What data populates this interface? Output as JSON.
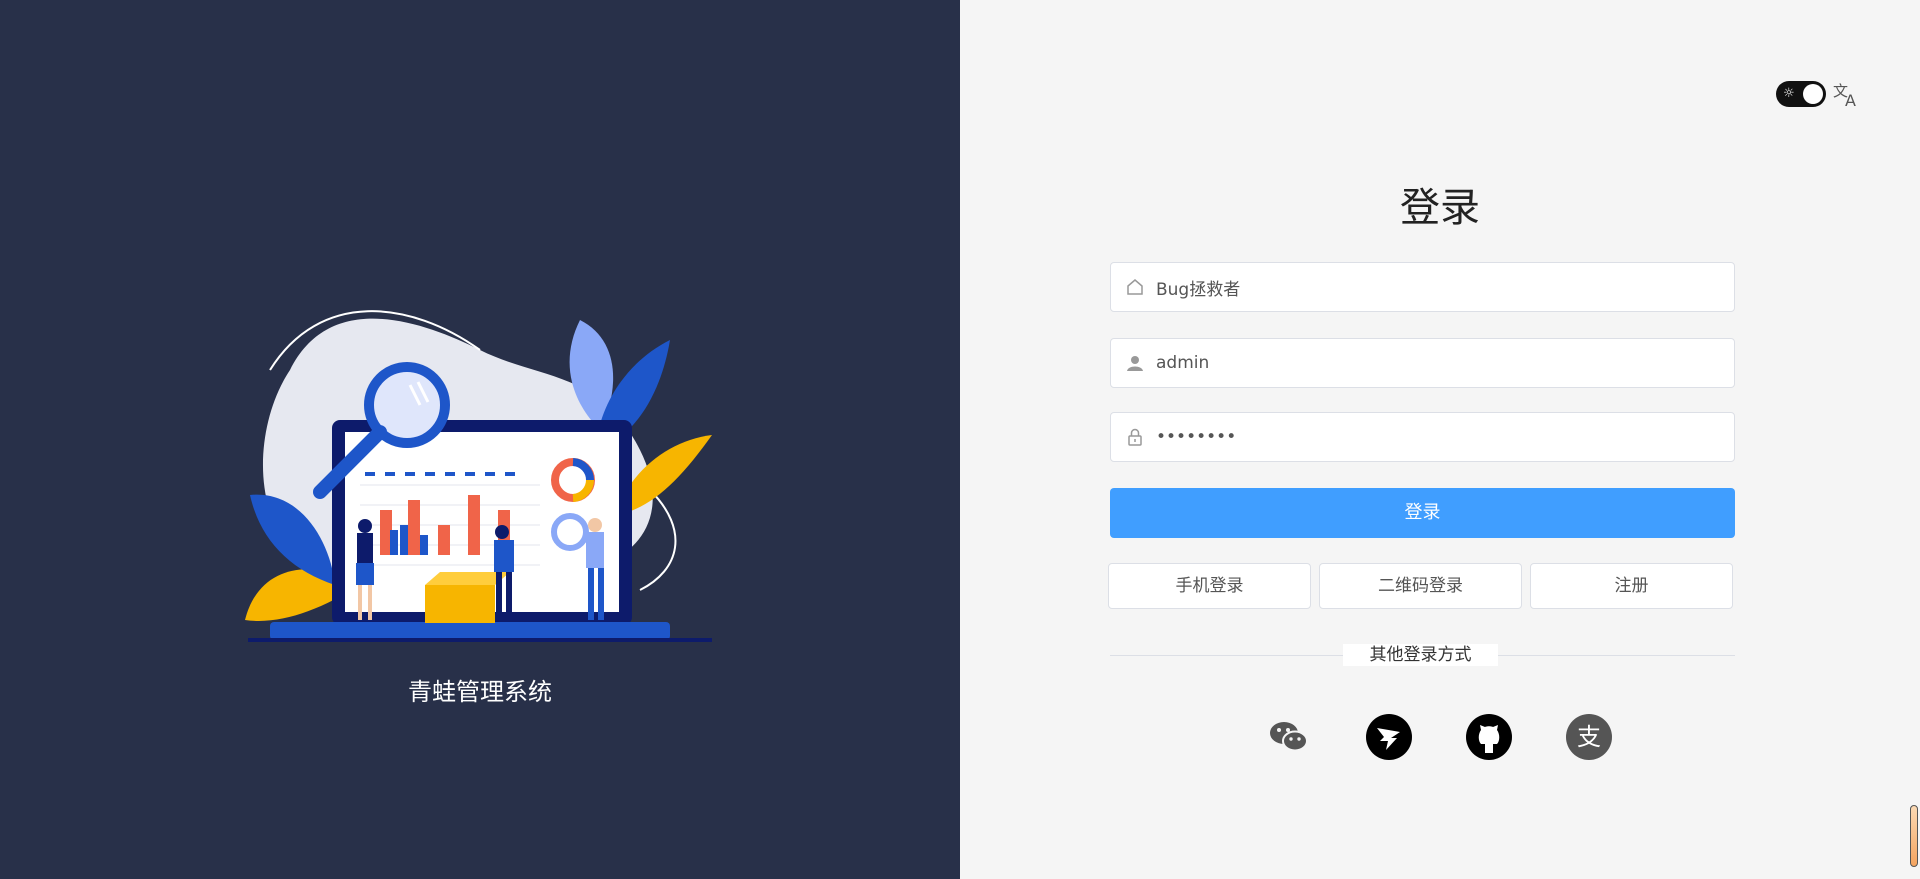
{
  "brand": {
    "app_name": "青蛙管理系统"
  },
  "header": {
    "theme_toggle_icon": "sun-icon",
    "language_icon": "translate-icon"
  },
  "login": {
    "title": "登录",
    "tenant_value": "Bug拯救者",
    "username_value": "admin",
    "password_value": "••••••••",
    "submit_label": "登录",
    "phone_login_label": "手机登录",
    "qrcode_login_label": "二维码登录",
    "register_label": "注册",
    "other_methods_label": "其他登录方式",
    "social_icons": [
      "wechat-icon",
      "dingtalk-icon",
      "github-icon",
      "alipay-icon"
    ]
  },
  "colors": {
    "left_background": "#283049",
    "right_background": "#f5f5f5",
    "primary": "#409eff"
  }
}
